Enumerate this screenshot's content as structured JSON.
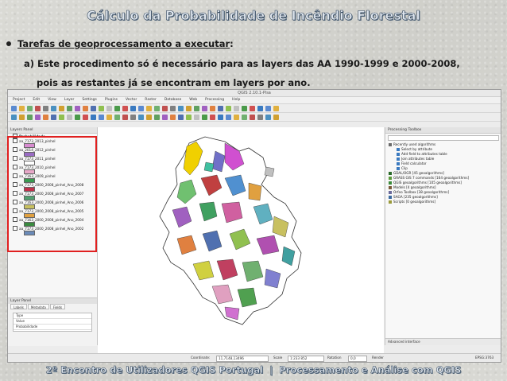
{
  "slide": {
    "title": "Cálculo da Probabilidade de Incêndio Florestal",
    "bullet_link": "Tarefas de geoprocessamento a executar",
    "bullet_colon": ":",
    "line_a": "a) Este procedimento só é necessário para as layers das AA 1990-1999 e 2000-2008,",
    "line_b": "pois as restantes já se encontram em layers por ano.",
    "footer_left": "2º Encontro de Utilizadores QGIS Portugal",
    "footer_sep": "|",
    "footer_right": "Processamento e Análise com QGIS"
  },
  "qgis": {
    "window_title": "QGIS 2.10.1-Pisa",
    "menu": [
      "Project",
      "Edit",
      "View",
      "Layer",
      "Settings",
      "Plugins",
      "Vector",
      "Raster",
      "Database",
      "Web",
      "Processing",
      "Help"
    ],
    "layers_header": "Layers Panel",
    "group": "Probabilidade",
    "layers": [
      {
        "name": "aa_7173_2013_pinhel",
        "swatch": "#d88bd0"
      },
      {
        "name": "aa_2014_2012_pinhel",
        "swatch": "#9a6cc4"
      },
      {
        "name": "aa_7173_2011_pinhel",
        "swatch": "#ffffff"
      },
      {
        "name": "aa_7173_2010_pinhel",
        "swatch": "#e8a8c8"
      },
      {
        "name": "aa_7163_2009_pinhel",
        "swatch": "#3a9a50"
      },
      {
        "name": "aa_7173_2000_2008_pinhel_Ano_2008",
        "swatch": "#c0304a"
      },
      {
        "name": "aa_7173_2000_2008_pinhel_Ano_2007",
        "swatch": "#50a070"
      },
      {
        "name": "aa_7163_2000_2008_pinhel_Ano_2006",
        "swatch": "#c8c060"
      },
      {
        "name": "aa_7173_2000_2008_pinhel_Ano_2005",
        "swatch": "#e0a040"
      },
      {
        "name": "aa_7163_2000_2008_pinhel_Ano_2004",
        "swatch": "#3a8a40"
      },
      {
        "name": "aa_7173_2000_2008_pinhel_Ano_2002",
        "swatch": "#6a8ab8"
      }
    ],
    "attr_header": "Layer Panel",
    "attr_tabs": [
      "Labels",
      "Metadata",
      "Fields"
    ],
    "attr_rows": [
      "Type",
      "Value",
      "Probabilidade"
    ],
    "right_header": "Processing Toolbox",
    "right_items": [
      {
        "label": "Recently used algorithms",
        "color": "#6a6a6a"
      },
      {
        "label": "Select by attribute",
        "color": "#3a7ac0"
      },
      {
        "label": "Add field to attributes table",
        "color": "#3a7ac0"
      },
      {
        "label": "Join attributes table",
        "color": "#3a7ac0"
      },
      {
        "label": "Field calculator",
        "color": "#3a7ac0"
      },
      {
        "label": "Clip",
        "color": "#3a7ac0"
      },
      {
        "label": "GDAL/OGR [45 geoalgorithms]",
        "color": "#2a6a2a"
      },
      {
        "label": "GRASS GIS 7 commands [164 geoalgorithms]",
        "color": "#5a9a3a"
      },
      {
        "label": "QGIS geoalgorithms [105 geoalgorithms]",
        "color": "#3a8a3a"
      },
      {
        "label": "Models [4 geoalgorithms]",
        "color": "#7a5a3a"
      },
      {
        "label": "Orfeo Toolbox [38 geoalgorithms]",
        "color": "#6a6a9a"
      },
      {
        "label": "SAGA [235 geoalgorithms]",
        "color": "#3a6aa0"
      },
      {
        "label": "Scripts [0 geoalgorithms]",
        "color": "#9a9a3a"
      }
    ],
    "right_bottom": "Advanced interface",
    "status_coordinate_label": "Coordinate:",
    "status_coordinate": "11,7148,13496",
    "status_scale_label": "Scale",
    "status_scale": "1:233 852",
    "status_rotation_label": "Rotation",
    "status_rotation": "0,0",
    "status_render": "Render",
    "status_crs": "EPSG:3763"
  },
  "colors": {
    "red_box": "#e02020",
    "title_fill": "#dfe6ee",
    "title_outline": "#2b3f55"
  }
}
